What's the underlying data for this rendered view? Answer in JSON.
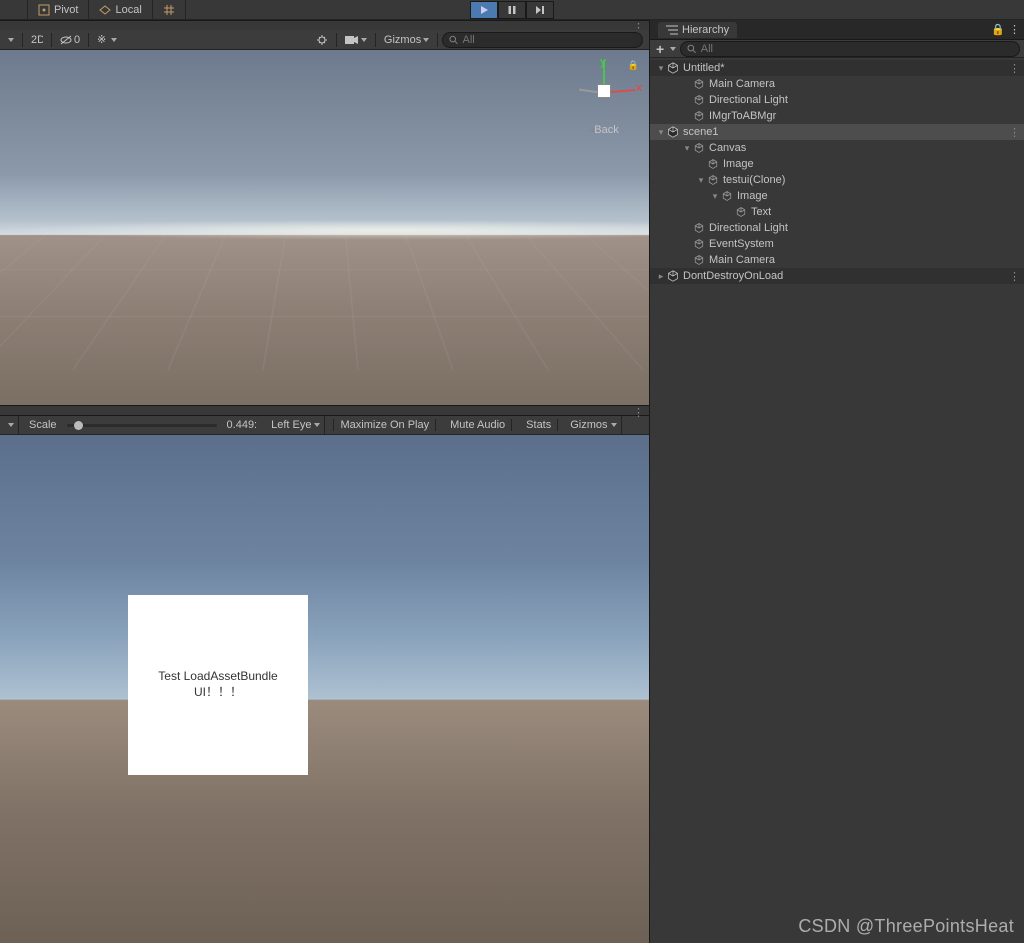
{
  "toolbar": {
    "pivot_label": "Pivot",
    "local_label": "Local"
  },
  "scene_tools": {
    "hidden_count": "0",
    "gizmos_label": "Gizmos",
    "search_placeholder": "All",
    "compass": {
      "x": "x",
      "y": "y",
      "back": "Back"
    }
  },
  "game_bar": {
    "scale_label": "Scale",
    "scale_value": "0.449:",
    "eye_label": "Left Eye",
    "maximize": "Maximize On Play",
    "mute": "Mute Audio",
    "stats": "Stats",
    "gizmos": "Gizmos"
  },
  "game_view": {
    "card_line1": "Test LoadAssetBundle",
    "card_line2": "UI！！！"
  },
  "hierarchy": {
    "tab_label": "Hierarchy",
    "search_placeholder": "All",
    "tree": [
      {
        "name": "Untitled*",
        "depth": 0,
        "type": "scene",
        "arrow": "open",
        "menu": true
      },
      {
        "name": "Main Camera",
        "depth": 1,
        "type": "go",
        "arrow": "none"
      },
      {
        "name": "Directional Light",
        "depth": 1,
        "type": "go",
        "arrow": "none"
      },
      {
        "name": "IMgrToABMgr",
        "depth": 1,
        "type": "go",
        "arrow": "none"
      },
      {
        "name": "scene1",
        "depth": 0,
        "type": "scene",
        "arrow": "open",
        "menu": true,
        "highlight": true
      },
      {
        "name": "Canvas",
        "depth": 1,
        "type": "go",
        "arrow": "open"
      },
      {
        "name": "Image",
        "depth": 2,
        "type": "go",
        "arrow": "none"
      },
      {
        "name": "testui(Clone)",
        "depth": 2,
        "type": "go",
        "arrow": "open"
      },
      {
        "name": "Image",
        "depth": 3,
        "type": "go",
        "arrow": "open"
      },
      {
        "name": "Text",
        "depth": 4,
        "type": "go",
        "arrow": "none"
      },
      {
        "name": "Directional Light",
        "depth": 1,
        "type": "go",
        "arrow": "none"
      },
      {
        "name": "EventSystem",
        "depth": 1,
        "type": "go",
        "arrow": "none"
      },
      {
        "name": "Main Camera",
        "depth": 1,
        "type": "go",
        "arrow": "none"
      },
      {
        "name": "DontDestroyOnLoad",
        "depth": 0,
        "type": "scene",
        "arrow": "closed",
        "menu": true
      }
    ]
  },
  "watermark": "CSDN @ThreePointsHeat"
}
